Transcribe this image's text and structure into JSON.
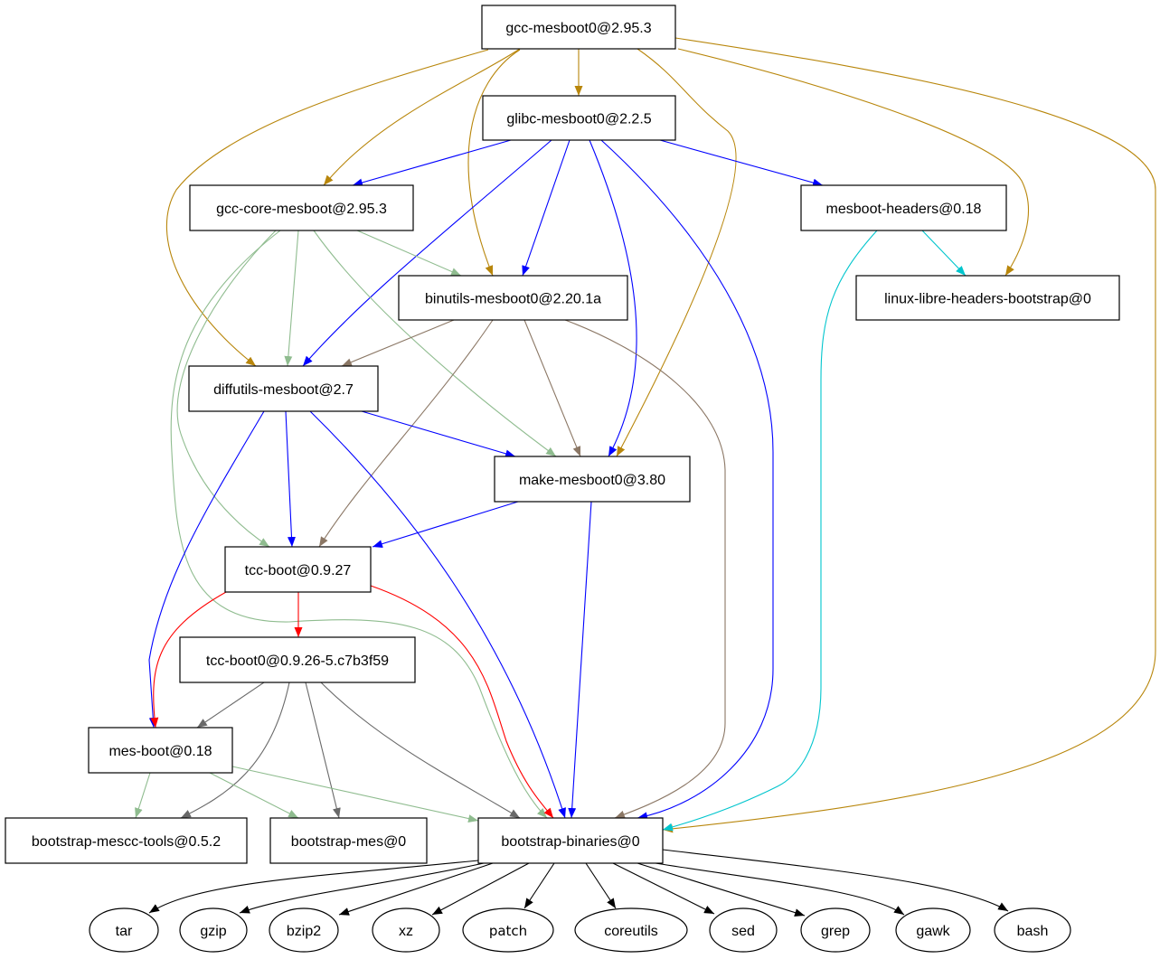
{
  "graph": {
    "nodes": [
      {
        "id": "gcc-mesboot0",
        "label": "gcc-mesboot0@2.95.3",
        "shape": "box"
      },
      {
        "id": "glibc-mesboot0",
        "label": "glibc-mesboot0@2.2.5",
        "shape": "box"
      },
      {
        "id": "gcc-core-mesboot",
        "label": "gcc-core-mesboot@2.95.3",
        "shape": "box"
      },
      {
        "id": "mesboot-headers",
        "label": "mesboot-headers@0.18",
        "shape": "box"
      },
      {
        "id": "binutils-mesboot0",
        "label": "binutils-mesboot0@2.20.1a",
        "shape": "box"
      },
      {
        "id": "linux-libre-headers-bootstrap",
        "label": "linux-libre-headers-bootstrap@0",
        "shape": "box"
      },
      {
        "id": "diffutils-mesboot",
        "label": "diffutils-mesboot@2.7",
        "shape": "box"
      },
      {
        "id": "make-mesboot0",
        "label": "make-mesboot0@3.80",
        "shape": "box"
      },
      {
        "id": "tcc-boot",
        "label": "tcc-boot@0.9.27",
        "shape": "box"
      },
      {
        "id": "tcc-boot0",
        "label": "tcc-boot0@0.9.26-5.c7b3f59",
        "shape": "box"
      },
      {
        "id": "mes-boot",
        "label": "mes-boot@0.18",
        "shape": "box"
      },
      {
        "id": "bootstrap-mescc-tools",
        "label": "bootstrap-mescc-tools@0.5.2",
        "shape": "box"
      },
      {
        "id": "bootstrap-mes",
        "label": "bootstrap-mes@0",
        "shape": "box"
      },
      {
        "id": "bootstrap-binaries",
        "label": "bootstrap-binaries@0",
        "shape": "box"
      },
      {
        "id": "tar",
        "label": "tar",
        "shape": "ellipse"
      },
      {
        "id": "gzip",
        "label": "gzip",
        "shape": "ellipse"
      },
      {
        "id": "bzip2",
        "label": "bzip2",
        "shape": "ellipse"
      },
      {
        "id": "xz",
        "label": "xz",
        "shape": "ellipse"
      },
      {
        "id": "patch",
        "label": "patch",
        "shape": "ellipse"
      },
      {
        "id": "coreutils",
        "label": "coreutils",
        "shape": "ellipse"
      },
      {
        "id": "sed",
        "label": "sed",
        "shape": "ellipse"
      },
      {
        "id": "grep",
        "label": "grep",
        "shape": "ellipse"
      },
      {
        "id": "gawk",
        "label": "gawk",
        "shape": "ellipse"
      },
      {
        "id": "bash",
        "label": "bash",
        "shape": "ellipse"
      }
    ],
    "edges": [
      [
        "gcc-mesboot0",
        "glibc-mesboot0",
        "#b8860b"
      ],
      [
        "gcc-mesboot0",
        "gcc-core-mesboot",
        "#b8860b"
      ],
      [
        "gcc-mesboot0",
        "diffutils-mesboot",
        "#b8860b"
      ],
      [
        "gcc-mesboot0",
        "binutils-mesboot0",
        "#b8860b"
      ],
      [
        "gcc-mesboot0",
        "make-mesboot0",
        "#b8860b"
      ],
      [
        "gcc-mesboot0",
        "linux-libre-headers-bootstrap",
        "#b8860b"
      ],
      [
        "gcc-mesboot0",
        "bootstrap-binaries",
        "#b8860b"
      ],
      [
        "glibc-mesboot0",
        "gcc-core-mesboot",
        "#0000ff"
      ],
      [
        "glibc-mesboot0",
        "mesboot-headers",
        "#0000ff"
      ],
      [
        "glibc-mesboot0",
        "diffutils-mesboot",
        "#0000ff"
      ],
      [
        "glibc-mesboot0",
        "binutils-mesboot0",
        "#0000ff"
      ],
      [
        "glibc-mesboot0",
        "make-mesboot0",
        "#0000ff"
      ],
      [
        "glibc-mesboot0",
        "bootstrap-binaries",
        "#0000ff"
      ],
      [
        "gcc-core-mesboot",
        "binutils-mesboot0",
        "#8fbc8f"
      ],
      [
        "gcc-core-mesboot",
        "diffutils-mesboot",
        "#8fbc8f"
      ],
      [
        "gcc-core-mesboot",
        "make-mesboot0",
        "#8fbc8f"
      ],
      [
        "gcc-core-mesboot",
        "tcc-boot",
        "#8fbc8f"
      ],
      [
        "gcc-core-mesboot",
        "bootstrap-binaries",
        "#8fbc8f"
      ],
      [
        "mesboot-headers",
        "linux-libre-headers-bootstrap",
        "#00c5cd"
      ],
      [
        "mesboot-headers",
        "bootstrap-binaries",
        "#00c5cd"
      ],
      [
        "binutils-mesboot0",
        "diffutils-mesboot",
        "#8b7765"
      ],
      [
        "binutils-mesboot0",
        "tcc-boot",
        "#8b7765"
      ],
      [
        "binutils-mesboot0",
        "make-mesboot0",
        "#8b7765"
      ],
      [
        "binutils-mesboot0",
        "bootstrap-binaries",
        "#8b7765"
      ],
      [
        "diffutils-mesboot",
        "make-mesboot0",
        "#0000ff"
      ],
      [
        "diffutils-mesboot",
        "tcc-boot",
        "#0000ff"
      ],
      [
        "diffutils-mesboot",
        "mes-boot",
        "#0000ff"
      ],
      [
        "diffutils-mesboot",
        "bootstrap-binaries",
        "#0000ff"
      ],
      [
        "make-mesboot0",
        "tcc-boot",
        "#0000ff"
      ],
      [
        "make-mesboot0",
        "bootstrap-binaries",
        "#0000ff"
      ],
      [
        "tcc-boot",
        "tcc-boot0",
        "#ff0000"
      ],
      [
        "tcc-boot",
        "mes-boot",
        "#ff0000"
      ],
      [
        "tcc-boot",
        "bootstrap-binaries",
        "#ff0000"
      ],
      [
        "tcc-boot0",
        "mes-boot",
        "#696969"
      ],
      [
        "tcc-boot0",
        "bootstrap-mescc-tools",
        "#696969"
      ],
      [
        "tcc-boot0",
        "bootstrap-mes",
        "#696969"
      ],
      [
        "tcc-boot0",
        "bootstrap-binaries",
        "#696969"
      ],
      [
        "mes-boot",
        "bootstrap-mescc-tools",
        "#8fbc8f"
      ],
      [
        "mes-boot",
        "bootstrap-mes",
        "#8fbc8f"
      ],
      [
        "mes-boot",
        "bootstrap-binaries",
        "#8fbc8f"
      ],
      [
        "bootstrap-binaries",
        "tar",
        "#000000"
      ],
      [
        "bootstrap-binaries",
        "gzip",
        "#000000"
      ],
      [
        "bootstrap-binaries",
        "bzip2",
        "#000000"
      ],
      [
        "bootstrap-binaries",
        "xz",
        "#000000"
      ],
      [
        "bootstrap-binaries",
        "patch",
        "#000000"
      ],
      [
        "bootstrap-binaries",
        "coreutils",
        "#000000"
      ],
      [
        "bootstrap-binaries",
        "sed",
        "#000000"
      ],
      [
        "bootstrap-binaries",
        "grep",
        "#000000"
      ],
      [
        "bootstrap-binaries",
        "gawk",
        "#000000"
      ],
      [
        "bootstrap-binaries",
        "bash",
        "#000000"
      ]
    ]
  }
}
